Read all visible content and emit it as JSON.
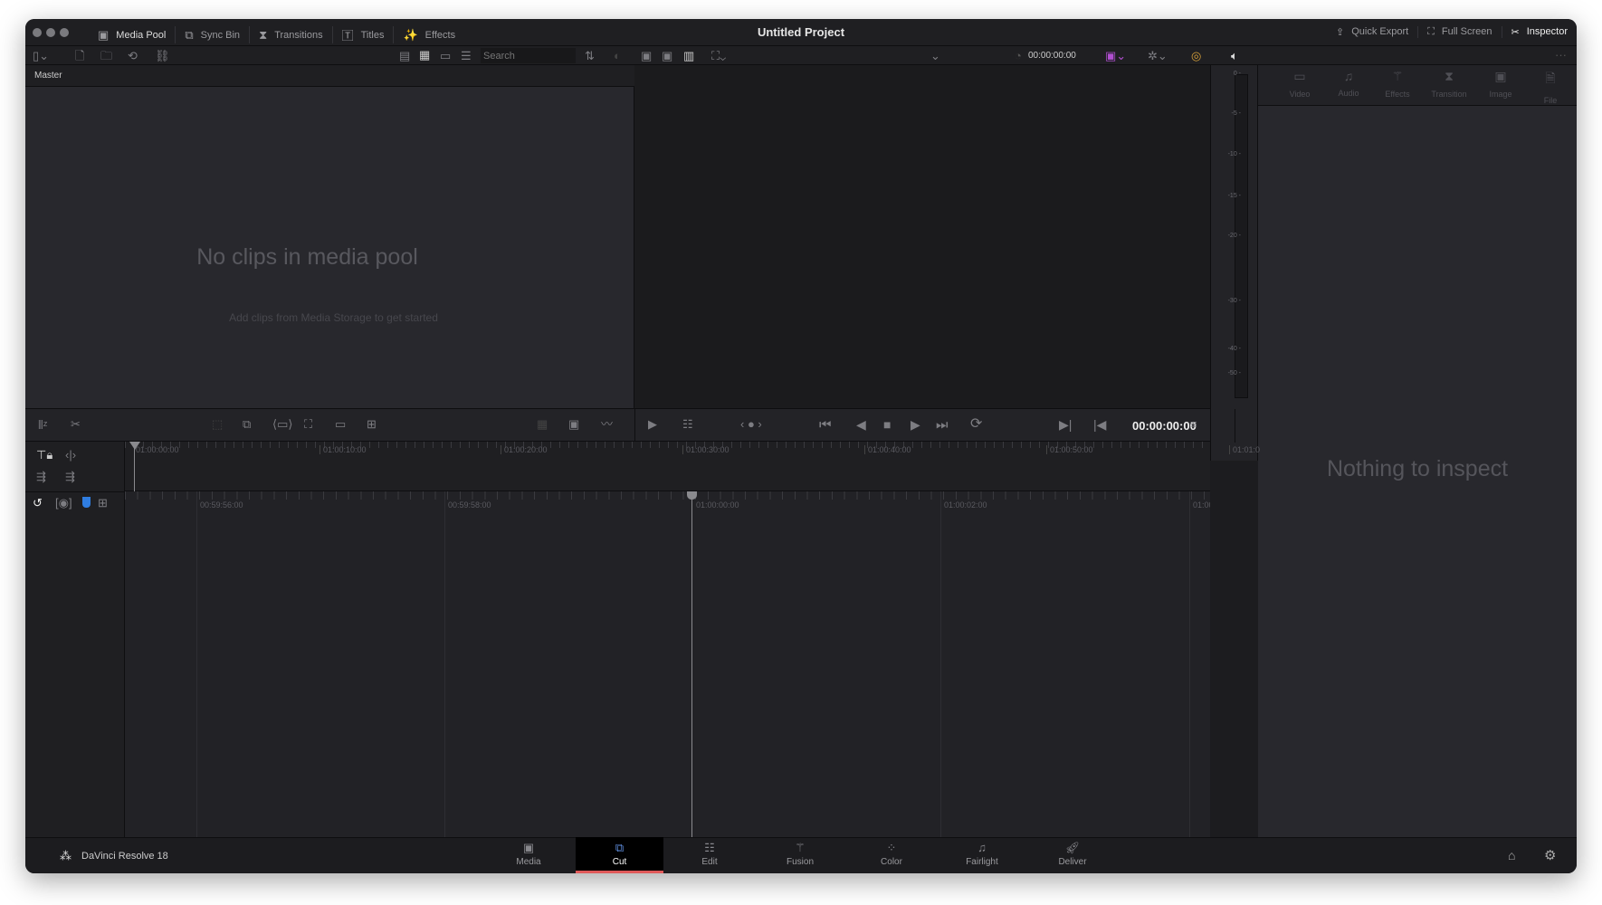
{
  "titlebar": {
    "tabs": [
      {
        "label": "Media Pool",
        "icon": "media-pool-icon"
      },
      {
        "label": "Sync Bin",
        "icon": "sync-bin-icon"
      },
      {
        "label": "Transitions",
        "icon": "transitions-icon"
      },
      {
        "label": "Titles",
        "icon": "titles-icon"
      },
      {
        "label": "Effects",
        "icon": "effects-icon"
      }
    ],
    "project_title": "Untitled Project",
    "right": [
      {
        "label": "Quick Export",
        "icon": "export-icon"
      },
      {
        "label": "Full Screen",
        "icon": "fullscreen-icon"
      },
      {
        "label": "Inspector",
        "icon": "inspector-icon"
      }
    ]
  },
  "media_pool": {
    "search_placeholder": "Search",
    "bin": "Master",
    "empty_title": "No clips in media pool",
    "empty_sub": "Add clips from Media Storage to get started"
  },
  "viewer": {
    "timecode": "00:00:00:00",
    "transport_timecode": "00:00:00:00"
  },
  "meter": {
    "labels": [
      "0 -",
      "-5 -",
      "-10 -",
      "-15 -",
      "-20 -",
      "-30 -",
      "-40 -",
      "-50 -"
    ]
  },
  "inspector": {
    "tabs": [
      "Video",
      "Audio",
      "Effects",
      "Transition",
      "Image",
      "File"
    ],
    "empty": "Nothing to inspect"
  },
  "timeline": {
    "upper_ruler": [
      "01:00:00:00",
      "01:00:10:00",
      "01:00:20:00",
      "01:00:30:00",
      "01:00:40:00",
      "01:00:50:00",
      "01:01:0"
    ],
    "lower_ruler": [
      "00:59:56:00",
      "00:59:58:00",
      "01:00:00:00",
      "01:00:02:00",
      "01:00:04:00"
    ]
  },
  "bottom": {
    "app_name": "DaVinci Resolve 18",
    "pages": [
      "Media",
      "Cut",
      "Edit",
      "Fusion",
      "Color",
      "Fairlight",
      "Deliver"
    ],
    "active": "Cut"
  },
  "colors": {
    "accent_active": "#e05a5a",
    "marker": "#2f7de1"
  }
}
